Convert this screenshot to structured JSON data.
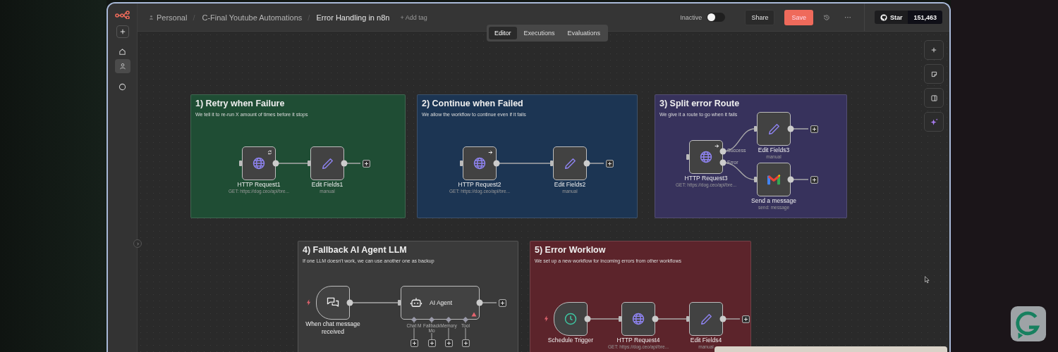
{
  "sidebar": {
    "items": [
      {
        "kind": "add",
        "selected": false
      },
      {
        "kind": "home",
        "selected": false
      },
      {
        "kind": "person",
        "selected": true
      },
      {
        "kind": "help",
        "selected": false
      }
    ]
  },
  "breadcrumb": {
    "owner": "Personal",
    "separator": "/",
    "folder": "C-Final Youtube Automations",
    "workflow": "Error Handling in n8n",
    "add_tag": "+ Add tag"
  },
  "status": {
    "label": "Inactive",
    "active": false
  },
  "actions": {
    "share": "Share",
    "save": "Save",
    "more": "···"
  },
  "github": {
    "label": "Star",
    "count": "151,463"
  },
  "view_tabs": [
    {
      "label": "Editor",
      "selected": true
    },
    {
      "label": "Executions",
      "selected": false
    },
    {
      "label": "Evaluations",
      "selected": false
    }
  ],
  "sticky_notes": [
    {
      "title": "1) Retry when Failure",
      "description": "We tell it to re-run X amount of times before it stops",
      "color": "#1f4d34",
      "nodes": [
        {
          "kind": "action",
          "name": "HTTP Request1",
          "subtitle": "GET: https://dog.ceo/api/bre..."
        },
        {
          "kind": "action",
          "name": "Edit Fields1",
          "subtitle": "manual"
        }
      ]
    },
    {
      "title": "2) Continue when Failed",
      "description": "We allow the workflow to continue even if it fails",
      "color": "#1c3553",
      "nodes": [
        {
          "kind": "action",
          "name": "HTTP Request2",
          "subtitle": "GET: https://dog.ceo/api/bre..."
        },
        {
          "kind": "action",
          "name": "Edit Fields2",
          "subtitle": "manual"
        }
      ]
    },
    {
      "title": "3) Split error Route",
      "description": "We give it a route to go when it fails",
      "color": "#37325c",
      "nodes": [
        {
          "kind": "action",
          "name": "HTTP Request3",
          "subtitle": "GET: https://dog.ceo/api/bre...",
          "outputs": [
            "Success",
            "Error"
          ]
        },
        {
          "kind": "action",
          "name": "Edit Fields3",
          "subtitle": "manual"
        },
        {
          "kind": "action",
          "name": "Send a message",
          "subtitle": "send: message"
        }
      ]
    },
    {
      "title": "4) Fallback AI Agent LLM",
      "description": "If one LLM doesn't work, we can use another one as backup",
      "color": "#3a3a3a",
      "nodes": [
        {
          "kind": "trigger",
          "name": "When chat message received"
        },
        {
          "kind": "agent",
          "name": "AI Agent",
          "warning": true,
          "ports": [
            "Chat M",
            "Fallback Mo",
            "Memory",
            "Tool"
          ]
        }
      ]
    },
    {
      "title": "5) Error Worklow",
      "description": "We set up a new workflow for incoming errors from other workflows",
      "color": "#5c242b",
      "nodes": [
        {
          "kind": "trigger",
          "name": "Schedule Trigger"
        },
        {
          "kind": "action",
          "name": "HTTP Request4",
          "subtitle": "GET: https://dog.ceo/api/bre..."
        },
        {
          "kind": "action",
          "name": "Edit Fields4",
          "subtitle": "manual"
        }
      ]
    }
  ]
}
